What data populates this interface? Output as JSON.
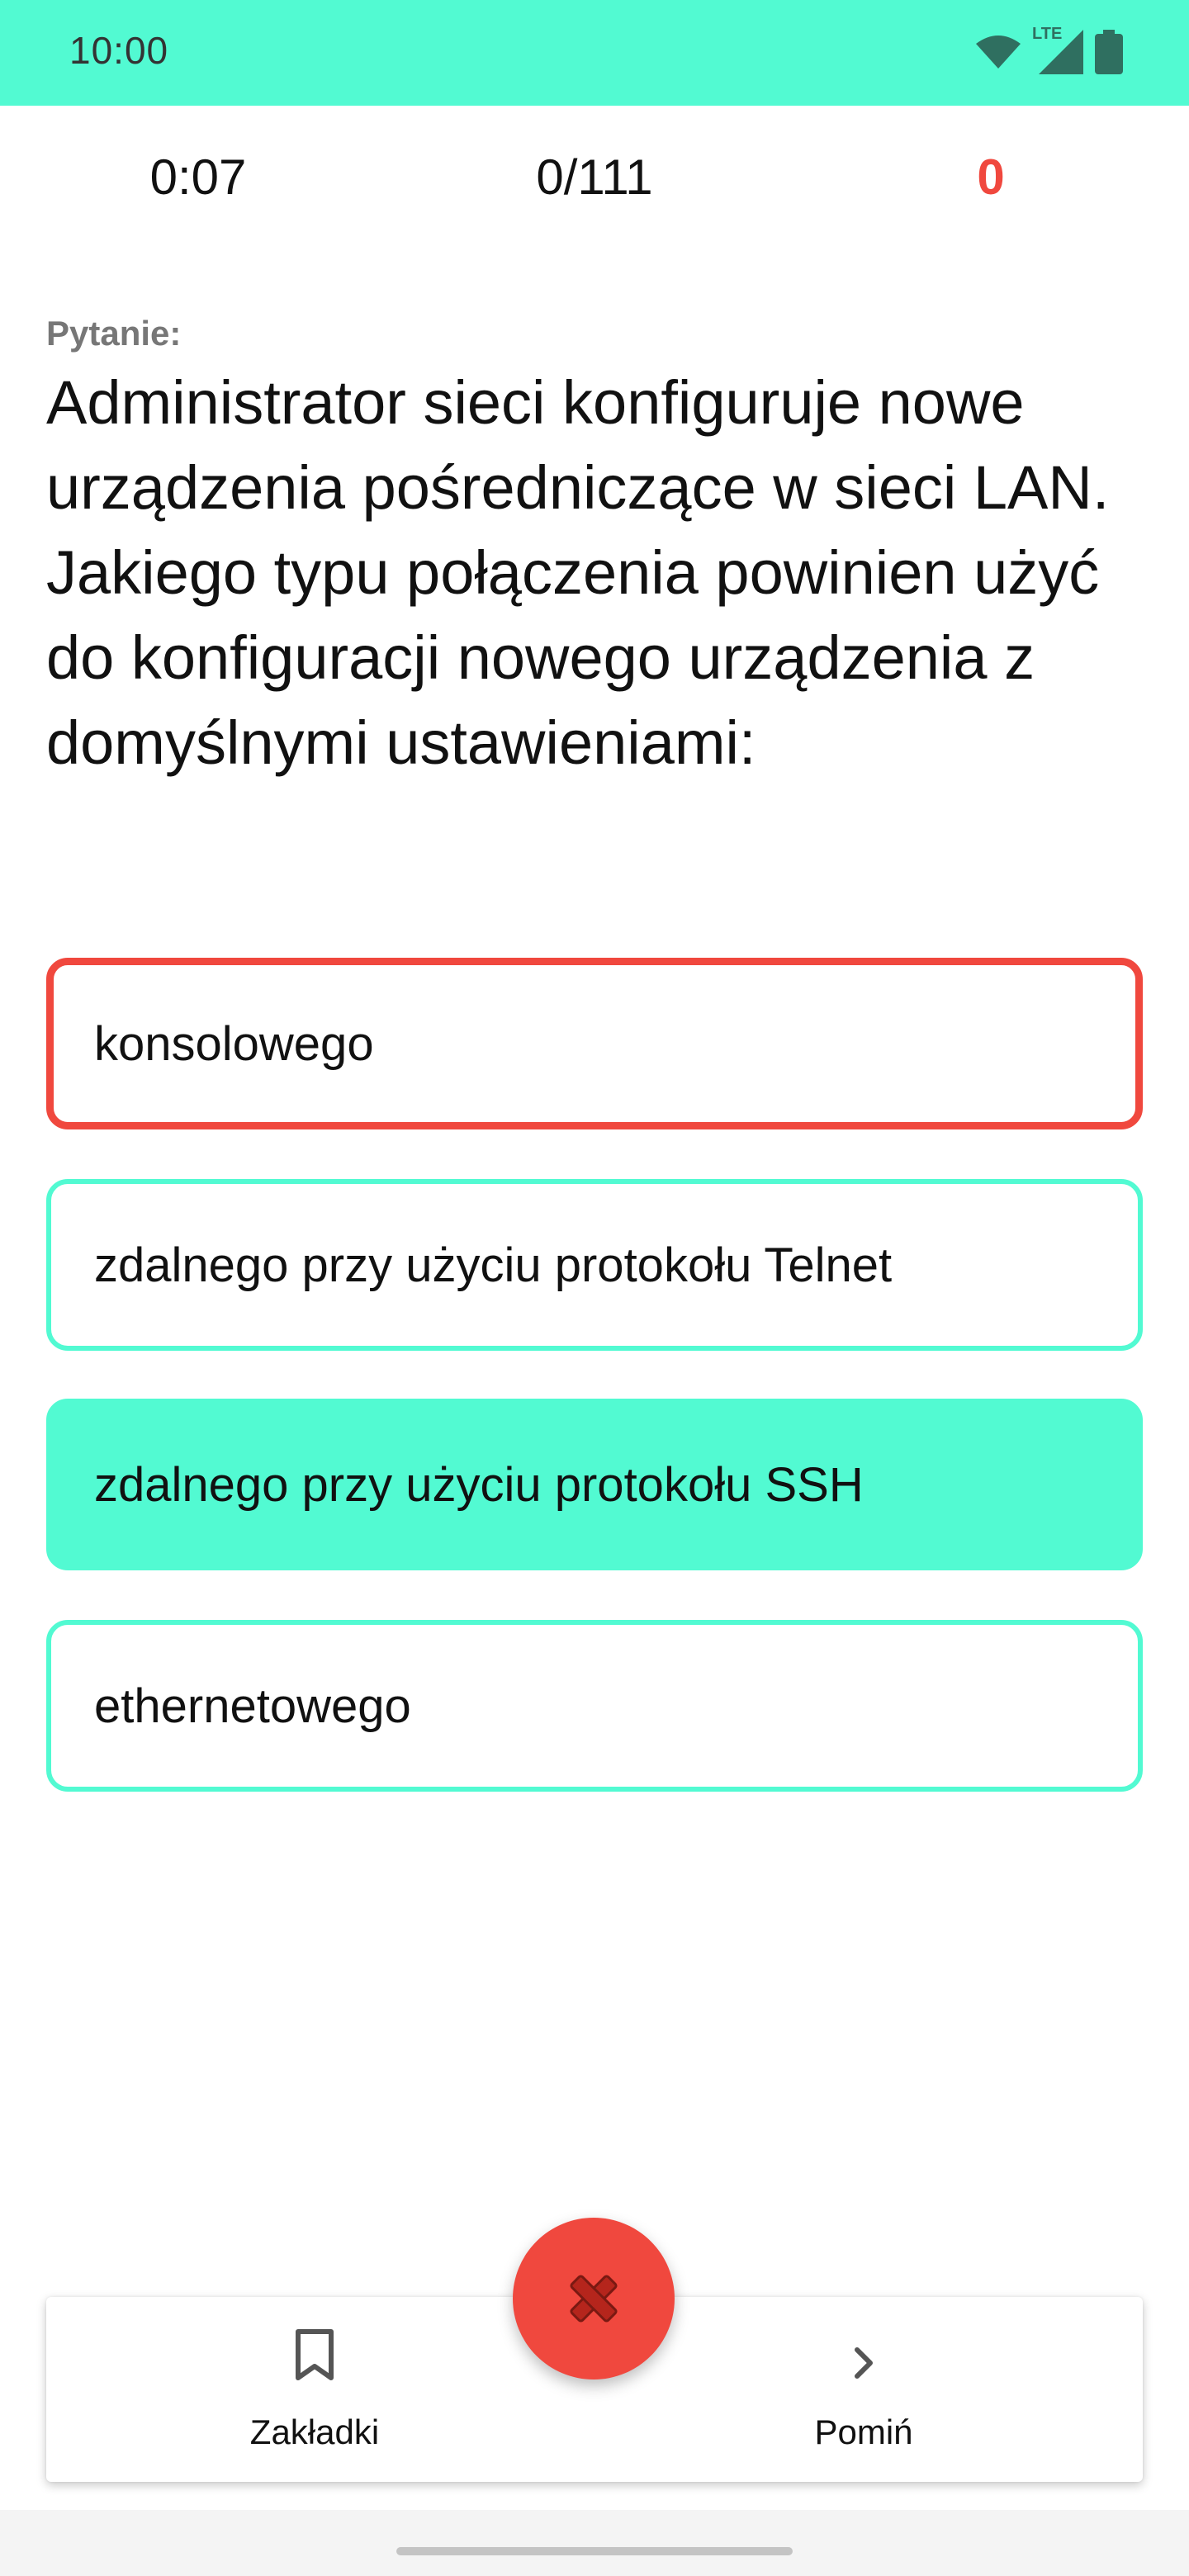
{
  "status_bar": {
    "time": "10:00",
    "network_label": "LTE",
    "icons": [
      "wifi-icon",
      "signal-icon",
      "battery-icon"
    ],
    "background_color": "#52fad2"
  },
  "stats": {
    "timer": "0:07",
    "progress": "0/111",
    "score": "0"
  },
  "question": {
    "caption": "Pytanie:",
    "text": "Administrator sieci konfiguruje nowe urządzenia pośredniczące w sieci LAN. Jakiego typu połączenia powinien użyć do konfiguracji nowego urządzenia z domyślnymi ustawieniami:"
  },
  "answers": [
    {
      "label": "konsolowego",
      "state": "wrong-selected"
    },
    {
      "label": "zdalnego przy użyciu protokołu Telnet",
      "state": "normal"
    },
    {
      "label": "zdalnego przy użyciu protokołu SSH",
      "state": "correct"
    },
    {
      "label": "ethernetowego",
      "state": "normal"
    }
  ],
  "bottom_nav": {
    "bookmarks_label": "Zakładki",
    "bookmarks_icon": "bookmark-icon",
    "skip_label": "Pomiń",
    "skip_icon": "chevron-right-icon",
    "fab_icon": "close-icon"
  },
  "colors": {
    "accent": "#52fad2",
    "error": "#f0483e"
  }
}
